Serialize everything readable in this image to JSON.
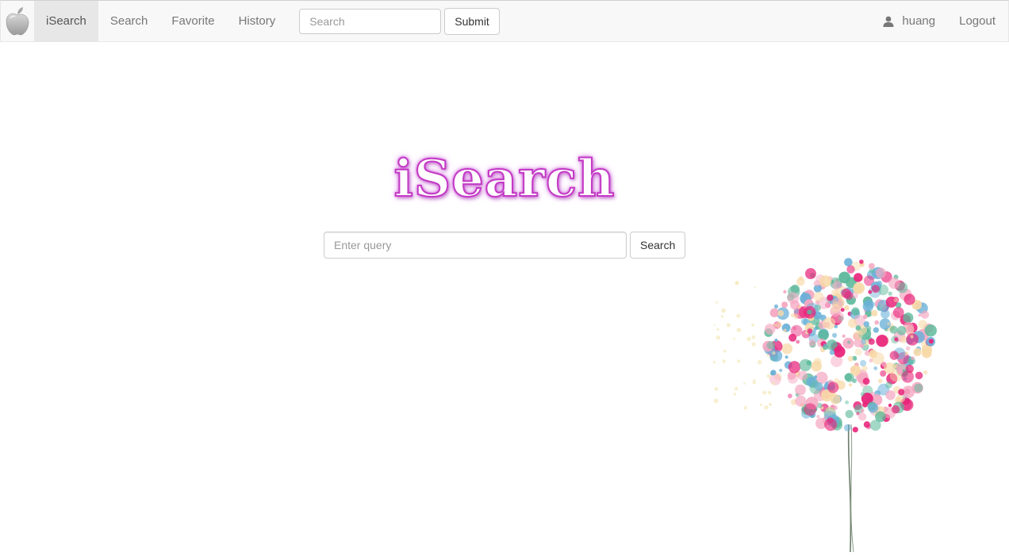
{
  "navbar": {
    "brand_icon": "apple-logo-icon",
    "items": [
      {
        "label": "iSearch",
        "active": true
      },
      {
        "label": "Search",
        "active": false
      },
      {
        "label": "Favorite",
        "active": false
      },
      {
        "label": "History",
        "active": false
      }
    ],
    "search_placeholder": "Search",
    "submit_label": "Submit",
    "user": {
      "icon": "user-icon",
      "name": "huang"
    },
    "logout_label": "Logout"
  },
  "main": {
    "logo_text": "iSearch",
    "logo_color": "#c33ac5",
    "query_placeholder": "Enter query",
    "search_button_label": "Search"
  },
  "decoration": {
    "image": "balloon-tree-illustration",
    "colors": [
      "#e8237a",
      "#5bb89a",
      "#6ab0d8",
      "#f4a6c0",
      "#f7d9a8"
    ]
  }
}
